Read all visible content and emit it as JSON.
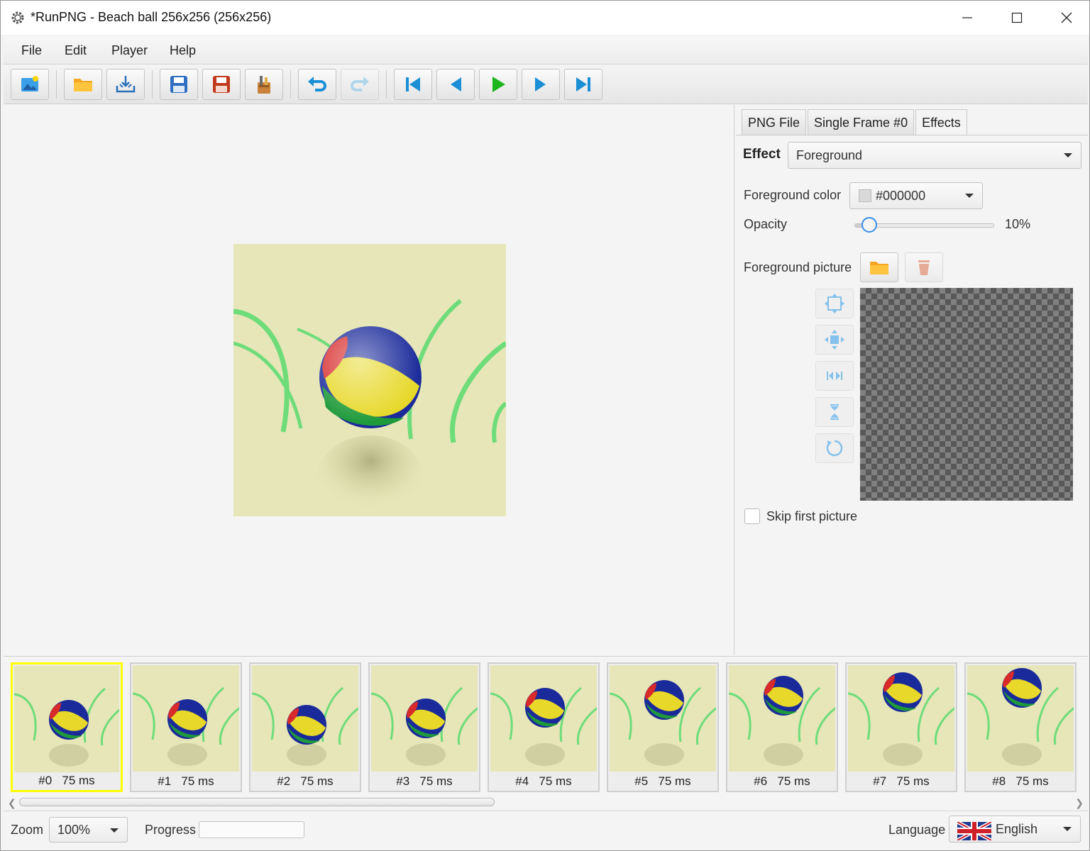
{
  "window": {
    "title": "*RunPNG - Beach ball 256x256 (256x256)",
    "minimize_label": "—",
    "maximize_label": "☐",
    "close_label": "✕"
  },
  "menu": [
    "File",
    "Edit",
    "Player",
    "Help"
  ],
  "toolbar": {
    "buttons": [
      "new-image",
      "open-folder",
      "import",
      "save",
      "save-as",
      "tools",
      "undo",
      "redo",
      "first-frame",
      "previous-frame",
      "play",
      "next-frame",
      "last-frame"
    ],
    "disabled": [
      "redo"
    ]
  },
  "panel": {
    "tabs": [
      "PNG File",
      "Single Frame #0",
      "Effects"
    ],
    "active_tab": "Effects",
    "effect_label": "Effect",
    "effect_value": "Foreground",
    "fg_color_label": "Foreground color",
    "fg_color_value": "#000000",
    "opacity_label": "Opacity",
    "opacity_value": "10%",
    "opacity_fraction": 0.1,
    "fg_picture_label": "Foreground picture",
    "skip_first_label": "Skip first picture",
    "skip_first_checked": false
  },
  "frames": [
    {
      "index": "#0",
      "duration": "75 ms"
    },
    {
      "index": "#1",
      "duration": "75 ms"
    },
    {
      "index": "#2",
      "duration": "75 ms"
    },
    {
      "index": "#3",
      "duration": "75 ms"
    },
    {
      "index": "#4",
      "duration": "75 ms"
    },
    {
      "index": "#5",
      "duration": "75 ms"
    },
    {
      "index": "#6",
      "duration": "75 ms"
    },
    {
      "index": "#7",
      "duration": "75 ms"
    },
    {
      "index": "#8",
      "duration": "75 ms"
    }
  ],
  "selected_frame": 0,
  "status": {
    "zoom_label": "Zoom",
    "zoom_value": "100%",
    "progress_label": "Progress",
    "progress_fraction": 0,
    "language_label": "Language",
    "language_value": "English"
  },
  "colors": {
    "accent": "#3a8ee6",
    "selected_frame_border": "#ffff00",
    "image_background": "#e6e6b8",
    "grass": "#6fdc7a"
  }
}
